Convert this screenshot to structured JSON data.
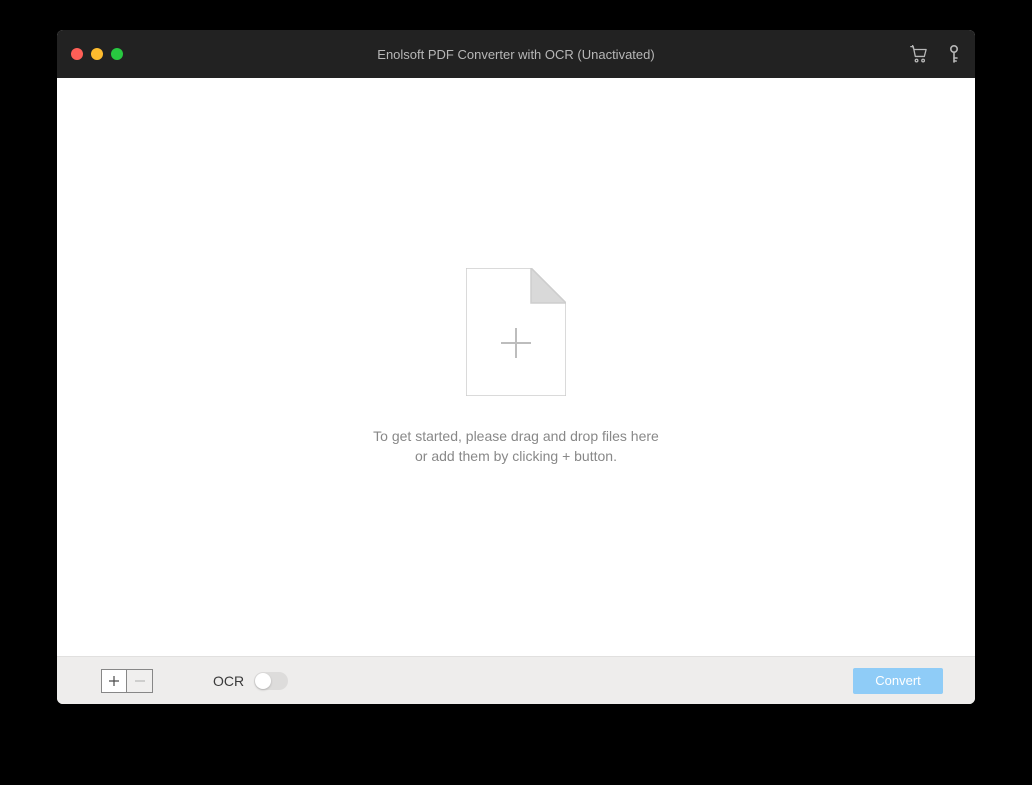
{
  "titlebar": {
    "title": "Enolsoft PDF Converter with OCR (Unactivated)"
  },
  "content": {
    "hint_line1": "To get started, please drag and drop files here",
    "hint_line2": "or add them by clicking + button."
  },
  "footer": {
    "ocr_label": "OCR",
    "convert_label": "Convert"
  }
}
